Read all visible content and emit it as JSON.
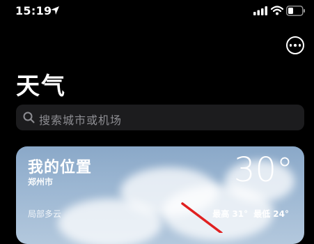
{
  "status_bar": {
    "time": "15:19"
  },
  "header": {
    "title": "天气"
  },
  "search": {
    "placeholder": "搜索城市或机场"
  },
  "location_card": {
    "name": "我的位置",
    "city": "郑州市",
    "temperature": "30°",
    "condition": "局部多云",
    "high": "最高 31°",
    "low": "最低 24°"
  },
  "icons": [
    "location-arrow-icon",
    "signal-icon",
    "wifi-icon",
    "battery-icon",
    "more-icon",
    "search-icon"
  ],
  "colors": {
    "background": "#000000",
    "search_bg": "#1c1c1e",
    "annotation_arrow": "#e02020"
  }
}
